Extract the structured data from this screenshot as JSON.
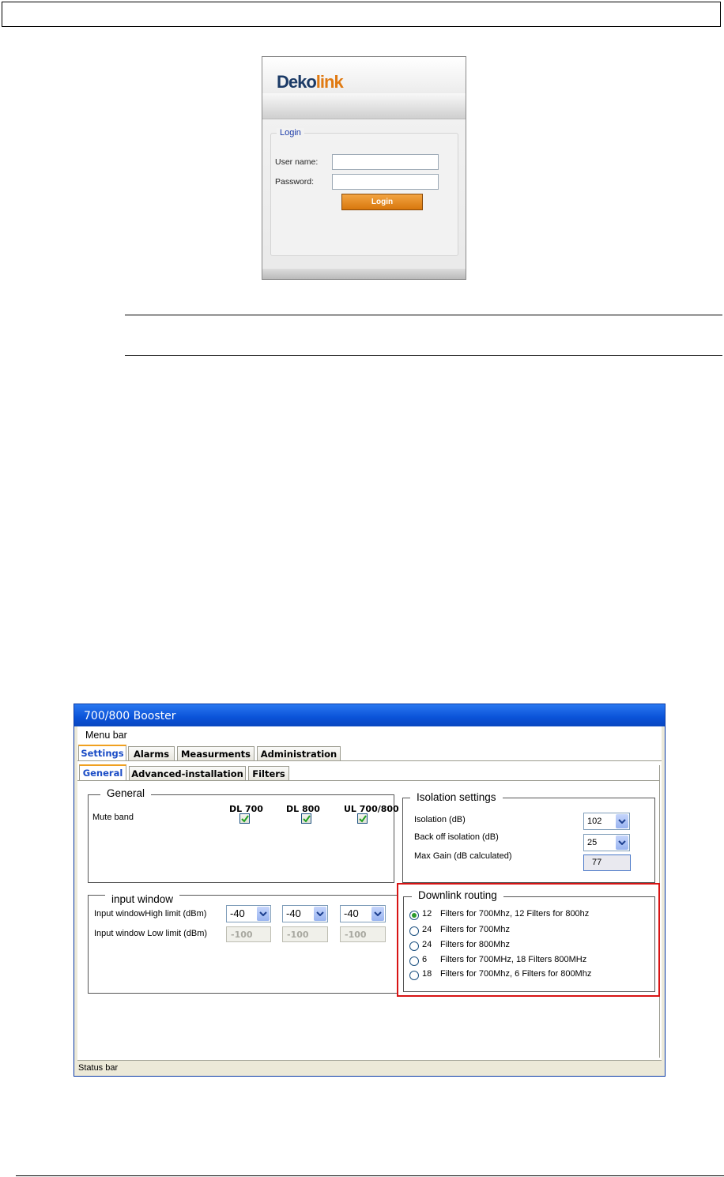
{
  "login": {
    "logo": {
      "part1": "Deko",
      "part2": "link"
    },
    "legend": "Login",
    "username_label": "User name:",
    "password_label": "Password:",
    "username_value": "",
    "password_value": "",
    "login_button": "Login"
  },
  "app": {
    "title": "700/800 Booster",
    "menu_bar": "Menu bar",
    "tabs": [
      {
        "label": "Settings",
        "active": true
      },
      {
        "label": "Alarms",
        "active": false
      },
      {
        "label": "Measurments",
        "active": false
      },
      {
        "label": "Administration",
        "active": false
      }
    ],
    "subtabs": [
      {
        "label": "General",
        "active": true
      },
      {
        "label": "Advanced-installation",
        "active": false
      },
      {
        "label": "Filters",
        "active": false
      }
    ],
    "general": {
      "title": "General",
      "columns": [
        "DL 700",
        "DL 800",
        "UL 700/800"
      ],
      "mute_band_label": "Mute band",
      "mute_band_checked": [
        true,
        true,
        true
      ]
    },
    "isolation": {
      "title": "Isolation settings",
      "isolation_label": "Isolation (dB)",
      "isolation_value": "102",
      "backoff_label": "Back off isolation (dB)",
      "backoff_value": "25",
      "max_gain_label": "Max Gain (dB calculated)",
      "max_gain_value": "77"
    },
    "input_window": {
      "title": "input window",
      "high_label": "Input windowHigh limit (dBm)",
      "high_values": [
        "-40",
        "-40",
        "-40"
      ],
      "low_label": "Input window Low limit (dBm)",
      "low_values": [
        "-100",
        "-100",
        "-100"
      ]
    },
    "downlink_routing": {
      "title": "Downlink routing",
      "options": [
        {
          "num": "12",
          "text": "Filters for 700Mhz,  12 Filters for 800hz",
          "selected": true
        },
        {
          "num": "24",
          "text": "Filters for 700Mhz",
          "selected": false
        },
        {
          "num": "24",
          "text": "Filters for 800Mhz",
          "selected": false
        },
        {
          "num": "6",
          "text": "Filters for 700MHz, 18 Filters 800MHz",
          "selected": false
        },
        {
          "num": "18",
          "text": "Filters for 700Mhz,  6 Filters for 800Mhz",
          "selected": false
        }
      ]
    },
    "status_bar": "Status bar"
  },
  "colors": {
    "title_bar": "#0a52d8",
    "login_button": "#e88a1e",
    "highlight_box": "#d81414",
    "active_tab_text": "#1a4cc6"
  }
}
